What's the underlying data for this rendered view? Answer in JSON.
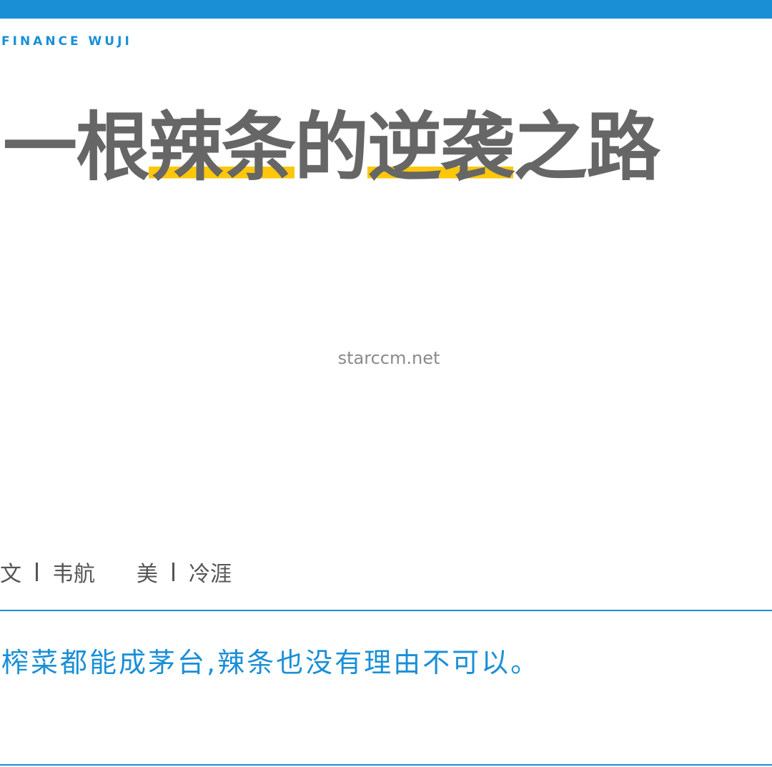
{
  "header": {
    "brand": "FINANCE WUJI",
    "accent_color": "#1a8fd6"
  },
  "title": {
    "segments": [
      {
        "text": "一根",
        "highlight": false
      },
      {
        "text": "辣条",
        "highlight": true
      },
      {
        "text": "的",
        "highlight": false
      },
      {
        "text": "逆袭",
        "highlight": true
      },
      {
        "text": "之路",
        "highlight": false
      }
    ],
    "highlight_color": "#ffc70a",
    "text_color": "#666666"
  },
  "watermark": "starccm.net",
  "byline": {
    "writer_label": "文",
    "writer_name": "韦航",
    "art_label": "美",
    "art_name": "冷涯"
  },
  "subtitle": "榨菜都能成茅台,辣条也没有理由不可以。"
}
